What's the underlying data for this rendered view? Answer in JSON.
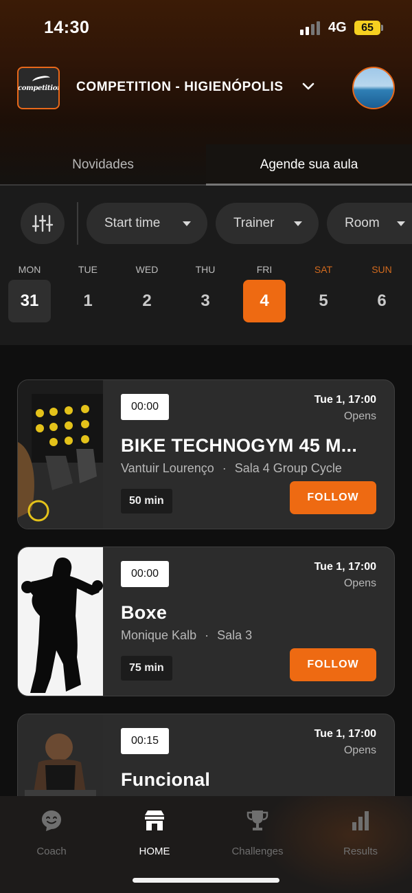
{
  "status_bar": {
    "time": "14:30",
    "network": "4G",
    "battery": "65"
  },
  "header": {
    "logo_text": "competition",
    "club_name": "COMPETITION - HIGIENÓPOLIS"
  },
  "tabs": [
    {
      "label": "Novidades"
    },
    {
      "label": "Agende sua aula"
    }
  ],
  "filters": {
    "chips": [
      {
        "label": "Start time"
      },
      {
        "label": "Trainer"
      },
      {
        "label": "Room"
      }
    ]
  },
  "calendar": {
    "days": [
      {
        "dow": "MON",
        "date": "31"
      },
      {
        "dow": "TUE",
        "date": "1"
      },
      {
        "dow": "WED",
        "date": "2"
      },
      {
        "dow": "THU",
        "date": "3"
      },
      {
        "dow": "FRI",
        "date": "4"
      },
      {
        "dow": "SAT",
        "date": "5"
      },
      {
        "dow": "SUN",
        "date": "6"
      }
    ],
    "highlighted": "31",
    "selected": "4"
  },
  "classes": [
    {
      "time": "00:00",
      "date": "Tue 1, 17:00",
      "status": "Opens",
      "title": "BIKE TECHNOGYM 45 M...",
      "trainer": "Vantuir Lourenço",
      "room": "Sala 4 Group Cycle",
      "duration": "50 min",
      "action": "FOLLOW"
    },
    {
      "time": "00:00",
      "date": "Tue 1, 17:00",
      "status": "Opens",
      "title": "Boxe",
      "trainer": "Monique Kalb",
      "room": "Sala 3",
      "duration": "75 min",
      "action": "FOLLOW"
    },
    {
      "time": "00:15",
      "date": "Tue 1, 17:00",
      "status": "Opens",
      "title": "Funcional"
    }
  ],
  "bottom_nav": [
    {
      "label": "Coach",
      "icon": "coach-icon"
    },
    {
      "label": "HOME",
      "icon": "home-icon"
    },
    {
      "label": "Challenges",
      "icon": "trophy-icon"
    },
    {
      "label": "Results",
      "icon": "bar-chart-icon"
    }
  ],
  "colors": {
    "accent": "#ee6a12",
    "card_bg": "#2c2c2c",
    "background": "#0f0f0f"
  }
}
